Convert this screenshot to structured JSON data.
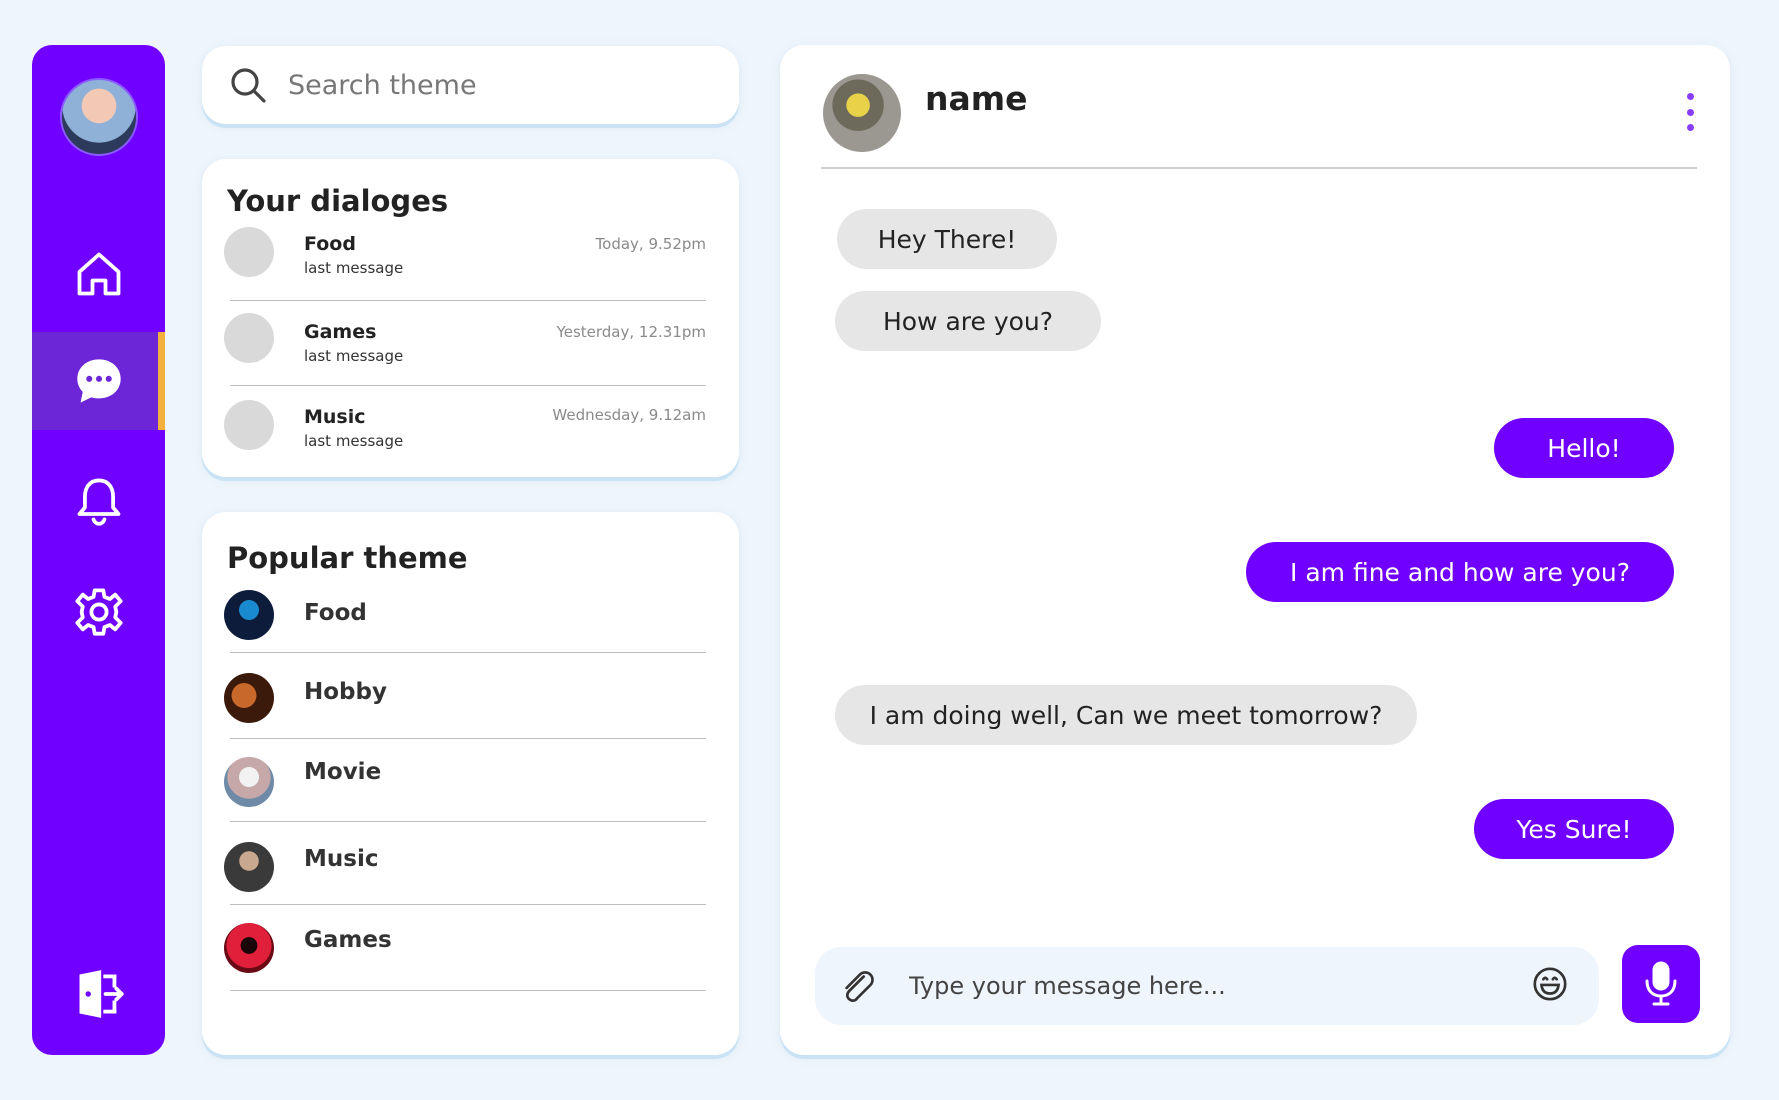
{
  "sidebar": {
    "avatar_icon": "user-avatar",
    "items": [
      {
        "icon": "home-icon",
        "active": false
      },
      {
        "icon": "chat-icon",
        "active": true
      },
      {
        "icon": "bell-icon",
        "active": false
      },
      {
        "icon": "gear-icon",
        "active": false
      }
    ],
    "logout_icon": "logout-icon",
    "accent_color": "#7000ff",
    "active_indicator_color": "#f4b03c"
  },
  "search": {
    "placeholder": "Search theme"
  },
  "dialogs": {
    "title": "Your dialoges",
    "items": [
      {
        "name": "Food",
        "last": "last message",
        "time": "Today, 9.52pm"
      },
      {
        "name": "Games",
        "last": "last message",
        "time": "Yesterday, 12.31pm"
      },
      {
        "name": "Music",
        "last": "last message",
        "time": "Wednesday, 9.12am"
      }
    ]
  },
  "popular": {
    "title": "Popular theme",
    "items": [
      {
        "name": "Food"
      },
      {
        "name": "Hobby"
      },
      {
        "name": "Movie"
      },
      {
        "name": "Music"
      },
      {
        "name": "Games"
      }
    ]
  },
  "chat": {
    "contact_name": "name",
    "messages": [
      {
        "dir": "in",
        "text": "Hey There!"
      },
      {
        "dir": "in",
        "text": "How are you?"
      },
      {
        "dir": "out",
        "text": "Hello!"
      },
      {
        "dir": "out",
        "text": "I am fine and how are you?"
      },
      {
        "dir": "in",
        "text": "I am doing well, Can we meet tomorrow?"
      },
      {
        "dir": "out",
        "text": "Yes Sure!"
      }
    ],
    "composer_placeholder": "Type your message here...",
    "bubble_in_color": "#e6e6e6",
    "bubble_out_color": "#7000ff"
  }
}
